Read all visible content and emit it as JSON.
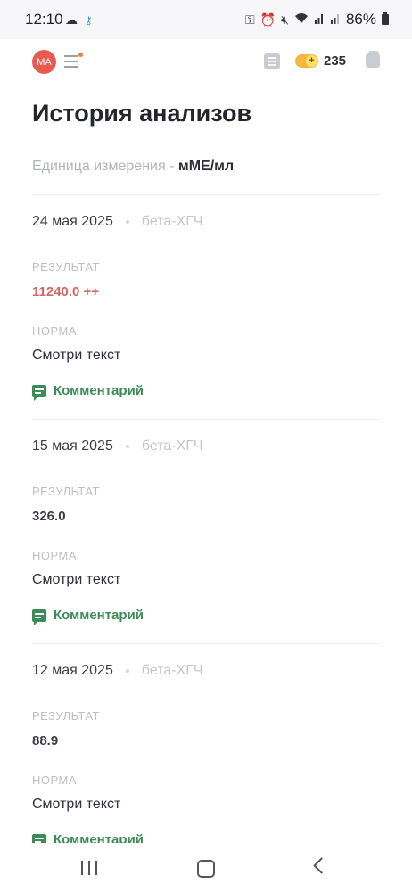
{
  "status_bar": {
    "time": "12:10",
    "battery": "86%",
    "left_icons": [
      "cloud-icon",
      "key-icon"
    ],
    "right_icons": [
      "vpn-key-icon",
      "alarm-icon",
      "mute-icon",
      "wifi-icon",
      "signal-icon",
      "signal-icon",
      "battery-icon"
    ]
  },
  "header": {
    "avatar_initials": "MA",
    "coins": "235"
  },
  "page": {
    "title": "История анализов",
    "units_label": "Единица измерения - ",
    "units_value": "мМЕ/мл"
  },
  "labels": {
    "result": "РЕЗУЛЬТАТ",
    "norm": "НОРМА",
    "comment": "Комментарий"
  },
  "entries": [
    {
      "date": "24 мая 2025",
      "test": "бета-ХГЧ",
      "result": "11240.0 ++",
      "result_flag": "high",
      "norm": "Смотри текст"
    },
    {
      "date": "15 мая 2025",
      "test": "бета-ХГЧ",
      "result": "326.0",
      "result_flag": "normal",
      "norm": "Смотри текст"
    },
    {
      "date": "12 мая 2025",
      "test": "бета-ХГЧ",
      "result": "88.9",
      "result_flag": "normal",
      "norm": "Смотри текст"
    }
  ],
  "colors": {
    "accent_green": "#3d8b58",
    "alert_red": "#d16a66",
    "avatar_red": "#e85a50",
    "coin_yellow": "#f4b73f"
  }
}
